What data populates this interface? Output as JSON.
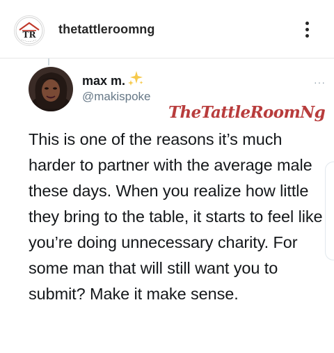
{
  "post": {
    "account_name": "thetattleroomng",
    "logo_text": "TR",
    "more_icon": "more-vertical-icon"
  },
  "tweet": {
    "display_name": "max m.",
    "emoji": "sparkles-icon",
    "handle": "@makispoke",
    "more_label": "···",
    "text": "This is one of the reasons it’s much harder to partner with the average male these days. When you realize how little they bring to the table, it starts to feel like you’re doing unnecessary charity. For some man that will still want you to submit? Make it make sense."
  },
  "watermark": "TheTattleRoomNg",
  "colors": {
    "watermark": "#b83c3c",
    "logo_red": "#c0392b",
    "handle": "#657786",
    "sparkle": "#f6c94b"
  }
}
